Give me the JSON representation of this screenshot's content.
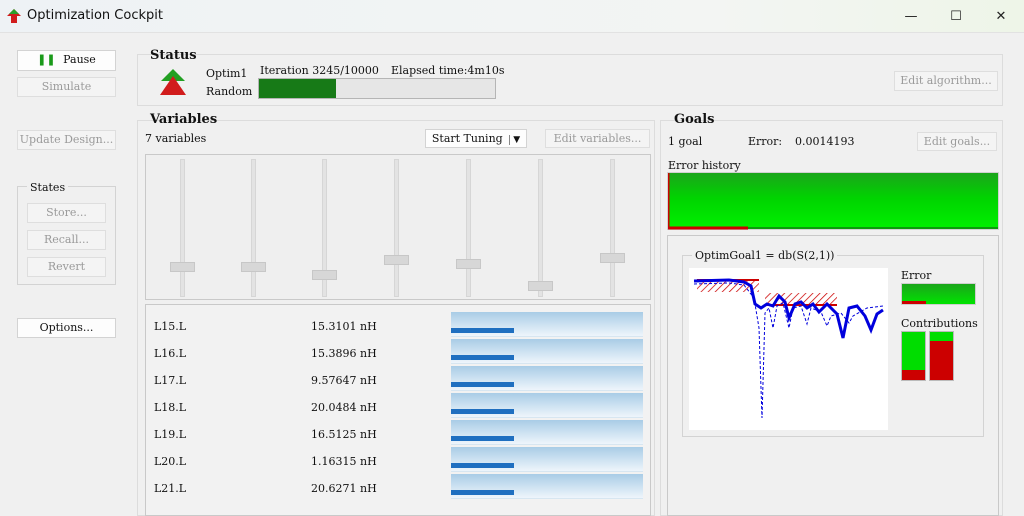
{
  "window": {
    "title": "Optimization Cockpit",
    "controls": [
      "—",
      "☐",
      "✕"
    ]
  },
  "left": {
    "pause_label": "Pause",
    "simulate_label": "Simulate",
    "update_design_label": "Update Design...",
    "states_title": "States",
    "store_label": "Store...",
    "recall_label": "Recall...",
    "revert_label": "Revert",
    "options_label": "Options..."
  },
  "status": {
    "title": "Status",
    "optimizer_name": "Optim1",
    "optimizer_type": "Random",
    "iteration_text": "Iteration 3245/10000",
    "elapsed_text": "Elapsed time:4m10s",
    "progress": 0.3245,
    "edit_algorithm_label": "Edit algorithm..."
  },
  "variables": {
    "title": "Variables",
    "count_text": "7 variables",
    "start_tuning_label": "Start Tuning",
    "edit_variables_label": "Edit variables...",
    "slider_levels": [
      0.18,
      0.18,
      0.12,
      0.23,
      0.2,
      0.04,
      0.25
    ],
    "items": [
      {
        "name": "L15.L",
        "value": "15.3101 nH",
        "fill": 0.33
      },
      {
        "name": "L16.L",
        "value": "15.3896 nH",
        "fill": 0.33
      },
      {
        "name": "L17.L",
        "value": "9.57647 nH",
        "fill": 0.33
      },
      {
        "name": "L18.L",
        "value": "20.0484 nH",
        "fill": 0.33
      },
      {
        "name": "L19.L",
        "value": "16.5125 nH",
        "fill": 0.33
      },
      {
        "name": "L20.L",
        "value": "1.16315 nH",
        "fill": 0.33
      },
      {
        "name": "L21.L",
        "value": "20.6271 nH",
        "fill": 0.33
      }
    ]
  },
  "goals": {
    "title": "Goals",
    "count_text": "1 goal",
    "error_label": "Error:",
    "error_value": "0.0014193",
    "edit_goals_label": "Edit goals...",
    "error_history_label": "Error history",
    "goal_box_title": "OptimGoal1 = db(S(2,1))",
    "error_bar_label": "Error",
    "contributions_label": "Contributions"
  },
  "colors": {
    "green": "#00cc00",
    "dark_green": "#177a17",
    "red": "#cc0000",
    "blue": "#0000dd"
  }
}
